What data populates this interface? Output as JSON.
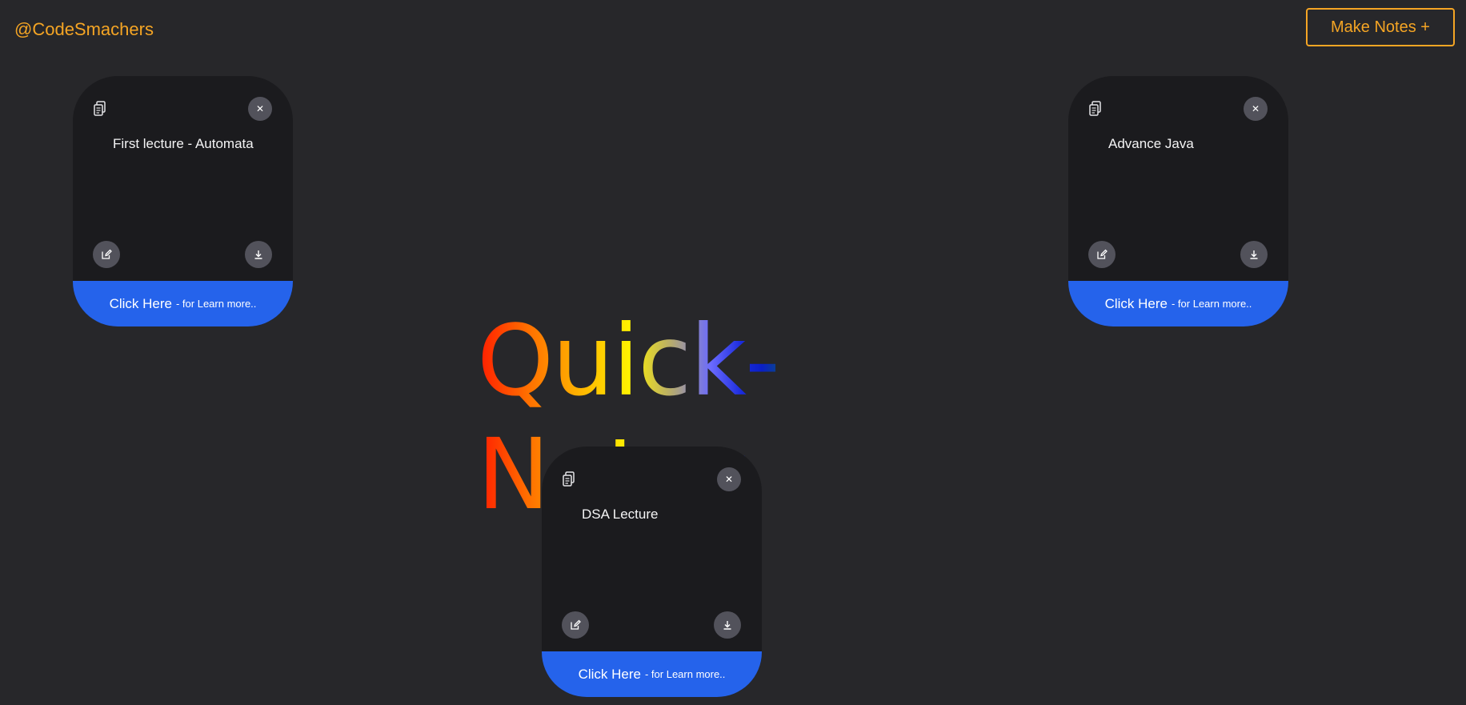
{
  "header": {
    "brand": "@CodeSmachers",
    "make_notes_label": "Make Notes +"
  },
  "hero": {
    "title": "Quick-Notes"
  },
  "notes": [
    {
      "text": "First lecture - Automata",
      "footer_cta": "Click Here",
      "footer_sub": "- for Learn more.."
    },
    {
      "text": "Advance Java",
      "footer_cta": "Click Here",
      "footer_sub": "- for Learn more.."
    },
    {
      "text": "DSA Lecture",
      "footer_cta": "Click Here",
      "footer_sub": "- for Learn more.."
    }
  ],
  "icons": {
    "copy": "clipboard-copy-icon",
    "close": "close-icon",
    "edit": "edit-icon",
    "download": "download-icon"
  },
  "colors": {
    "background": "#27272a",
    "card": "#1b1b1e",
    "accent": "#f5a524",
    "footer": "#2563eb",
    "icon_button": "#52525b"
  }
}
